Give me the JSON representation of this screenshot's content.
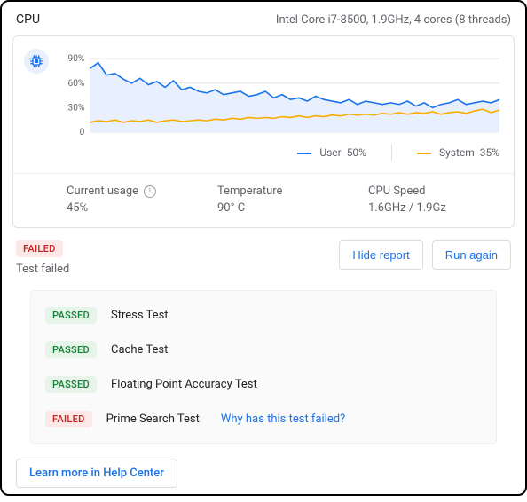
{
  "header": {
    "title": "CPU",
    "subtitle": "Intel Core i7-8500, 1.9GHz, 4 cores (8 threads)"
  },
  "chart_data": {
    "type": "line",
    "ylabel": "",
    "yticks": [
      "90%",
      "60%",
      "30%",
      "0"
    ],
    "ylim": [
      0,
      100
    ],
    "series": [
      {
        "name": "User",
        "legend_value": "50%",
        "color": "#1a73e8",
        "values": [
          78,
          85,
          70,
          72,
          65,
          60,
          66,
          58,
          62,
          55,
          63,
          52,
          55,
          50,
          48,
          52,
          46,
          48,
          50,
          44,
          46,
          50,
          42,
          46,
          40,
          42,
          38,
          44,
          40,
          38,
          36,
          40,
          34,
          38,
          36,
          34,
          36,
          34,
          38,
          32,
          36,
          30,
          34,
          36,
          40,
          34,
          36,
          38,
          36,
          40
        ]
      },
      {
        "name": "System",
        "legend_value": "35%",
        "color": "#f9ab00",
        "values": [
          12,
          14,
          13,
          15,
          12,
          14,
          13,
          15,
          12,
          14,
          15,
          13,
          14,
          15,
          14,
          16,
          15,
          17,
          16,
          18,
          17,
          18,
          17,
          19,
          18,
          20,
          18,
          20,
          19,
          21,
          20,
          22,
          21,
          22,
          21,
          23,
          22,
          24,
          22,
          24,
          23,
          25,
          22,
          24,
          25,
          23,
          26,
          28,
          24,
          27
        ]
      }
    ]
  },
  "legend": {
    "user_label": "User",
    "user_value": "50%",
    "system_label": "System",
    "system_value": "35%"
  },
  "metrics": {
    "current_usage_label": "Current usage",
    "current_usage_value": "45%",
    "temperature_label": "Temperature",
    "temperature_value": "90° C",
    "cpu_speed_label": "CPU Speed",
    "cpu_speed_value": "1.6GHz / 1.9Gz"
  },
  "status": {
    "badge": "FAILED",
    "text": "Test failed",
    "hide_report": "Hide report",
    "run_again": "Run again"
  },
  "tests": [
    {
      "badge": "PASSED",
      "name": "Stress Test"
    },
    {
      "badge": "PASSED",
      "name": "Cache Test"
    },
    {
      "badge": "PASSED",
      "name": "Floating Point Accuracy Test"
    },
    {
      "badge": "FAILED",
      "name": "Prime Search Test",
      "help": "Why has this test failed?"
    }
  ],
  "help_link": "Learn more in Help Center",
  "colors": {
    "user": "#1a73e8",
    "system": "#f9ab00"
  }
}
